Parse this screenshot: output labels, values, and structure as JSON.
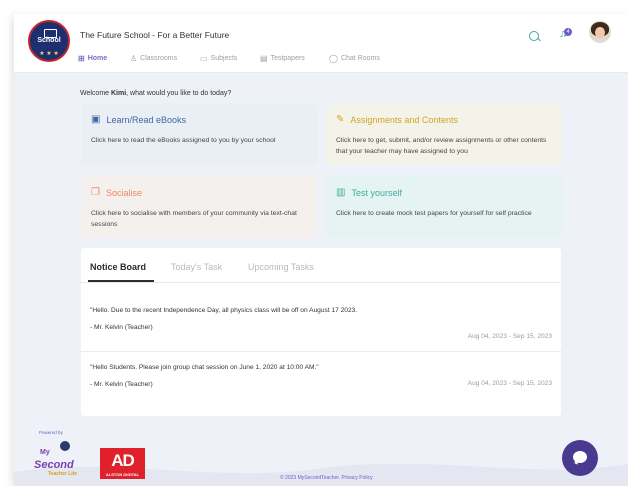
{
  "header": {
    "logo_text": "School",
    "school_title": "The Future School - For a Better Future",
    "notification_count": "4"
  },
  "nav": [
    {
      "label": "Home",
      "icon": "grid-icon"
    },
    {
      "label": "Classrooms",
      "icon": "person-icon"
    },
    {
      "label": "Subjects",
      "icon": "book-icon"
    },
    {
      "label": "Testpapers",
      "icon": "document-icon"
    },
    {
      "label": "Chat Rooms",
      "icon": "chat-icon"
    }
  ],
  "welcome": {
    "prefix": "Welcome ",
    "name": "Kimi",
    "suffix": ", what would you like to do today?"
  },
  "cards": [
    {
      "title": "Learn/Read eBooks",
      "desc": "Click here to read the eBooks assigned to you by your school",
      "color": "#3f66a8"
    },
    {
      "title": "Assignments and Contents",
      "desc": "Click here to get, submit, and/or review assignments or other contents that your teacher may have assigned to you",
      "color": "#d4a21f"
    },
    {
      "title": "Socialise",
      "desc": "Click here to socialise with members of your community via text-chat sessions",
      "color": "#ec8a5a"
    },
    {
      "title": "Test yourself",
      "desc": "Click here to create mock test papers for yourself for self practice",
      "color": "#3bb09c"
    }
  ],
  "notice_board": {
    "tabs": [
      "Notice Board",
      "Today's Task",
      "Upcoming Tasks"
    ],
    "items": [
      {
        "message": "\"Hello. Due to the recent Independence Day, all physics class will be  off on August 17 2023.",
        "author": "- Mr. Kelvin (Teacher)",
        "dates": "Aug 04, 2023  - Sep 15, 2023"
      },
      {
        "message": "\"Hello Students. Please join group chat session on June 1, 2020 at 10:00 AM.\"",
        "author": "- Mr. Kelvin (Teacher)",
        "dates": "Aug 04, 2023  - Sep 15, 2023"
      }
    ]
  },
  "footer": {
    "powered_by": "Powered by",
    "mst_my": "My",
    "mst_name": "Second",
    "mst_sub": "Teacher Lite",
    "ad_mark": "AD",
    "ad_text": "ALSTON DIGITAL",
    "copyright": "© 2023 MySecondTeacher. Privacy Policy"
  },
  "colors": {
    "accent": "#6b5fc7",
    "nav_active": "#7a6fc4",
    "chat_button": "#4a3a8f"
  }
}
